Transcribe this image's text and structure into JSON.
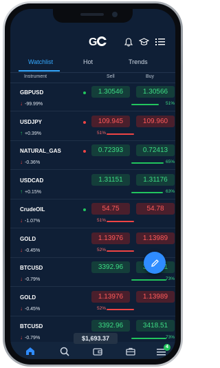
{
  "header": {
    "logo": "GO",
    "icons": [
      "bell-icon",
      "graduation-cap-icon",
      "list-icon"
    ]
  },
  "tabs": [
    {
      "label": "Watchlist",
      "active": true
    },
    {
      "label": "Hot",
      "active": false
    },
    {
      "label": "Trends",
      "active": false
    }
  ],
  "columns": {
    "instrument": "Instrument",
    "sell": "Sell",
    "buy": "Buy"
  },
  "instruments": [
    {
      "symbol": "GBPUSD",
      "direction": "down",
      "change": "-99.99%",
      "dot": "green",
      "sell": "1.30546",
      "buy": "1.30566",
      "tone": "green",
      "pct": "51%",
      "pct_value": 51,
      "side": "buy"
    },
    {
      "symbol": "USDJPY",
      "direction": "up",
      "change": "+0.39%",
      "dot": "red",
      "sell": "109.945",
      "buy": "109.960",
      "tone": "red",
      "pct": "51%",
      "pct_value": 51,
      "side": "sell"
    },
    {
      "symbol": "NATURAL_GAS",
      "direction": "down",
      "change": "-0.36%",
      "dot": "red",
      "sell": "0.72393",
      "buy": "0.72413",
      "tone": "green",
      "pct": "65%",
      "pct_value": 65,
      "side": "buy"
    },
    {
      "symbol": "USDCAD",
      "direction": "up",
      "change": "+0.15%",
      "dot": "",
      "sell": "1.31151",
      "buy": "1.31176",
      "tone": "green",
      "pct": "63%",
      "pct_value": 63,
      "side": "buy"
    },
    {
      "symbol": "CrudeOIL",
      "direction": "down",
      "change": "-1.07%",
      "dot": "green",
      "sell": "54.75",
      "buy": "54.78",
      "tone": "red",
      "pct": "51%",
      "pct_value": 51,
      "side": "sell"
    },
    {
      "symbol": "GOLD",
      "direction": "down",
      "change": "-0.45%",
      "dot": "",
      "sell": "1.13976",
      "buy": "1.13989",
      "tone": "red",
      "pct": "52%",
      "pct_value": 52,
      "side": "sell"
    },
    {
      "symbol": "BTCUSD",
      "direction": "down",
      "change": "-0.79%",
      "dot": "",
      "sell": "3392.96",
      "buy": "3418.51",
      "tone": "green",
      "pct": "73%",
      "pct_value": 73,
      "side": "buy"
    },
    {
      "symbol": "GOLD",
      "direction": "down",
      "change": "-0.45%",
      "dot": "",
      "sell": "1.13976",
      "buy": "1.13989",
      "tone": "red",
      "pct": "52%",
      "pct_value": 52,
      "side": "sell"
    },
    {
      "symbol": "BTCUSD",
      "direction": "down",
      "change": "-0.79%",
      "dot": "",
      "sell": "3392.96",
      "buy": "3418.51",
      "tone": "green",
      "pct": "73%",
      "pct_value": 73,
      "side": "buy"
    }
  ],
  "balance": "$1,693.37",
  "bottom_nav": [
    {
      "icon": "home-icon",
      "active": true
    },
    {
      "icon": "search-icon",
      "active": false
    },
    {
      "icon": "wallet-icon",
      "active": false
    },
    {
      "icon": "briefcase-icon",
      "active": false
    },
    {
      "icon": "menu-icon",
      "active": false,
      "badge": "4"
    }
  ],
  "colors": {
    "accent": "#34a9ff",
    "up": "#3ddc84",
    "down": "#ff5a5a",
    "background": "#0f1f36"
  }
}
